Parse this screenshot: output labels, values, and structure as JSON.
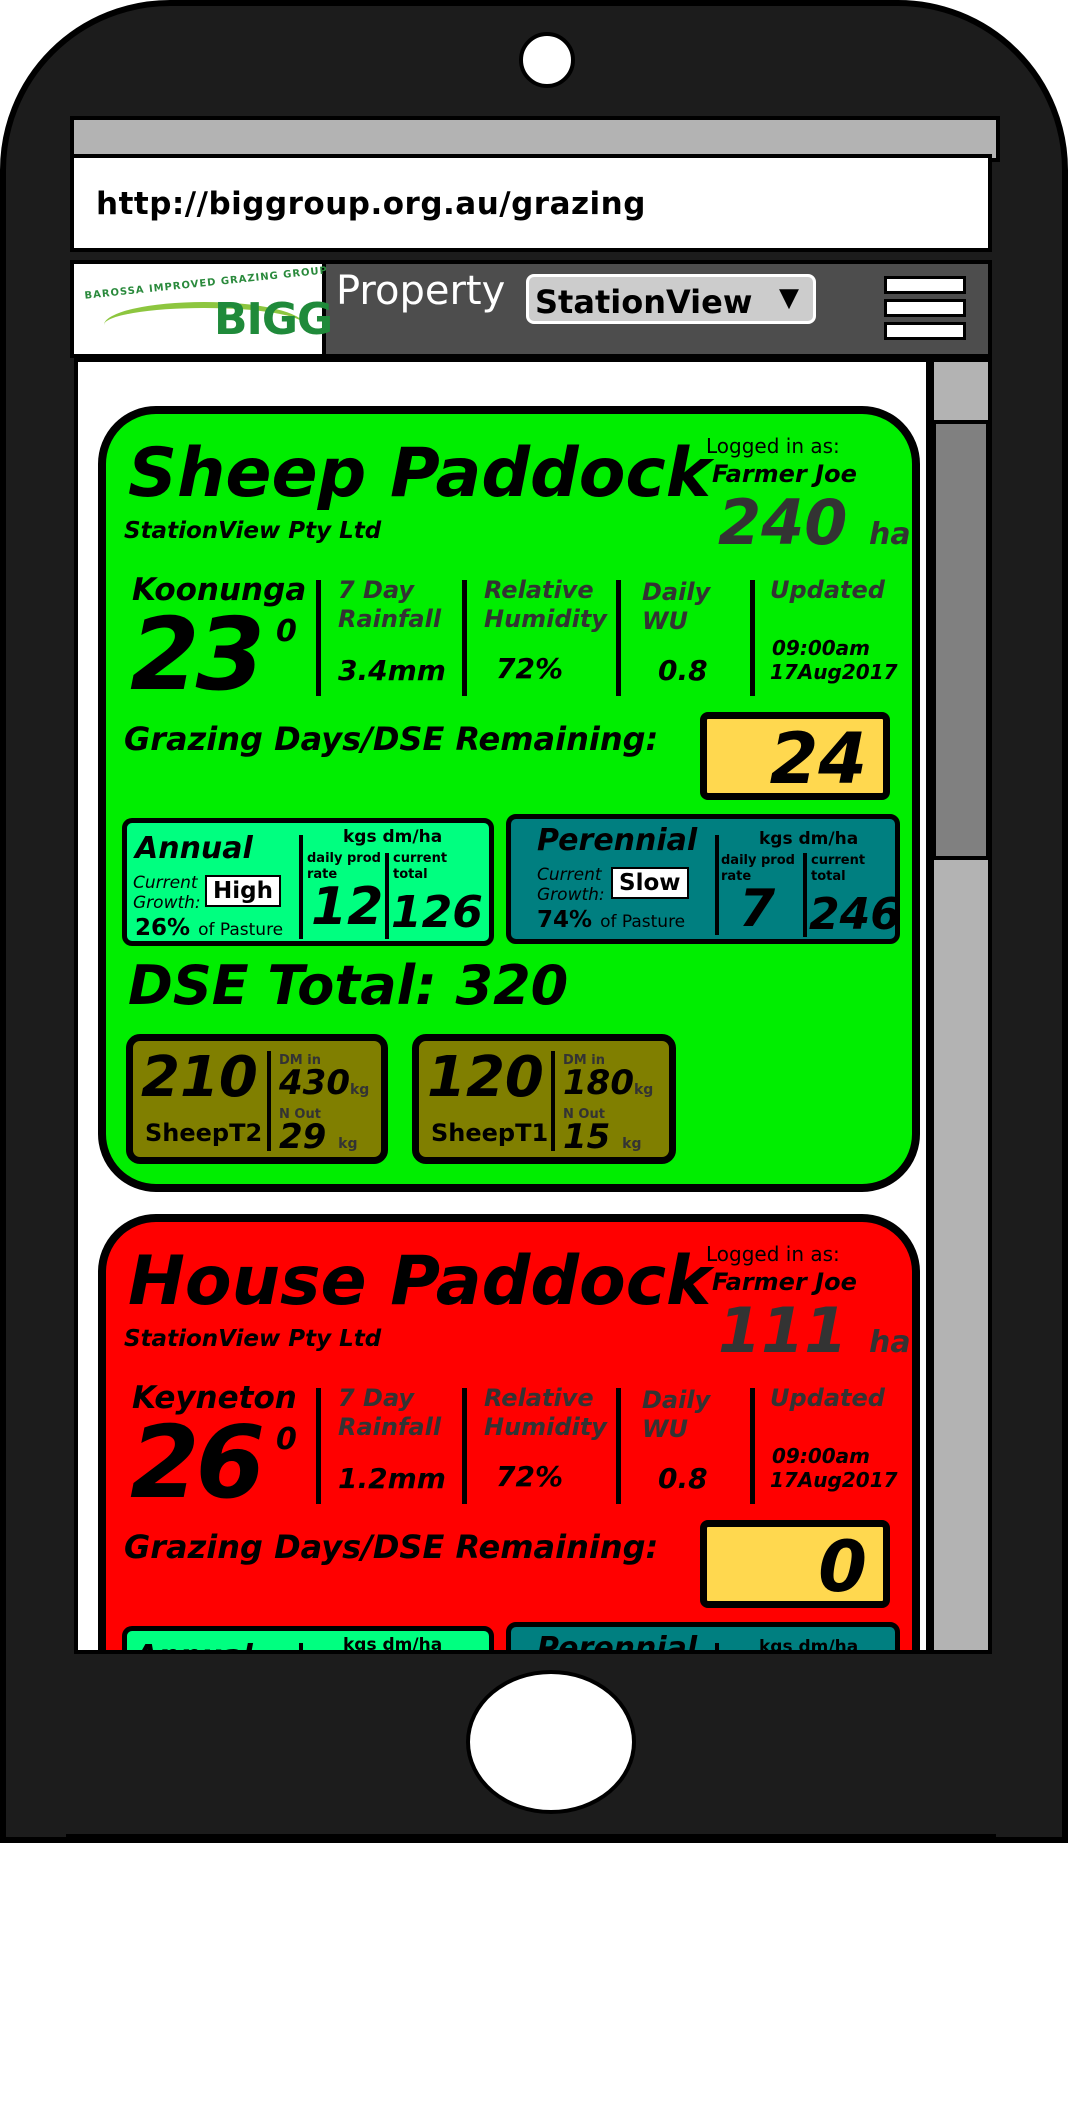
{
  "browser": {
    "url": "http://biggroup.org.au/grazing"
  },
  "nav": {
    "logo_arc_text": "BAROSSA IMPROVED GRAZING GROUP",
    "logo_text": "BIGG",
    "property_label": "Property",
    "property_value": "StationView",
    "dropdown_arrow": "▼"
  },
  "cards": [
    {
      "name": "Sheep Paddock",
      "company": "StationView Pty Ltd",
      "logged_label": "Logged in as:",
      "logged_user": "Farmer Joe",
      "area_value": "240",
      "area_unit": "ha",
      "location": "Koonunga",
      "temperature": "23",
      "degree_symbol": "0",
      "rainfall_label": "7 Day Rainfall",
      "rainfall_value": "3.4mm",
      "humidity_label": "Relative Humidity",
      "humidity_value": "72%",
      "wu_label": "Daily WU",
      "wu_value": "0.8",
      "updated_label": "Updated",
      "updated_time": "09:00am",
      "updated_date": "17Aug2017",
      "grazing_label": "Grazing Days/DSE Remaining:",
      "grazing_value": "24",
      "annual": {
        "title": "Annual",
        "growth_label": "Current Growth:",
        "growth_value": "High",
        "pct": "26%",
        "pct_suffix": "of Pasture",
        "units": "kgs dm/ha",
        "prod_label": "daily prod rate",
        "total_label": "current total",
        "prod_value": "12",
        "total_value": "126"
      },
      "perennial": {
        "title": "Perennial",
        "growth_label": "Current Growth:",
        "growth_value": "Slow",
        "pct": "74%",
        "pct_suffix": "of Pasture",
        "units": "kgs dm/ha",
        "prod_label": "daily prod rate",
        "total_label": "current total",
        "prod_value": "7",
        "total_value": "246"
      },
      "dse_total_label": "DSE Total: 320",
      "mobs": [
        {
          "count": "210",
          "name": "SheepT2",
          "dm_label": "DM in",
          "dm_value": "430",
          "dm_unit": "kg",
          "n_label": "N Out",
          "n_value": "29",
          "n_unit": "kg"
        },
        {
          "count": "120",
          "name": "SheepT1",
          "dm_label": "DM in",
          "dm_value": "180",
          "dm_unit": "kg",
          "n_label": "N Out",
          "n_value": "15",
          "n_unit": "kg"
        }
      ]
    },
    {
      "name": "House Paddock",
      "company": "StationView Pty Ltd",
      "logged_label": "Logged in as:",
      "logged_user": "Farmer Joe",
      "area_value": "111",
      "area_unit": "ha",
      "location": "Keyneton",
      "temperature": "26",
      "degree_symbol": "0",
      "rainfall_label": "7 Day Rainfall",
      "rainfall_value": "1.2mm",
      "humidity_label": "Relative Humidity",
      "humidity_value": "72%",
      "wu_label": "Daily WU",
      "wu_value": "0.8",
      "updated_label": "Updated",
      "updated_time": "09:00am",
      "updated_date": "17Aug2017",
      "grazing_label": "Grazing Days/DSE Remaining:",
      "grazing_value": "0",
      "annual": {
        "title": "Annual",
        "units": "kgs dm/ha"
      },
      "perennial": {
        "title": "Perennial",
        "units": "kgs dm/ha"
      }
    }
  ]
}
